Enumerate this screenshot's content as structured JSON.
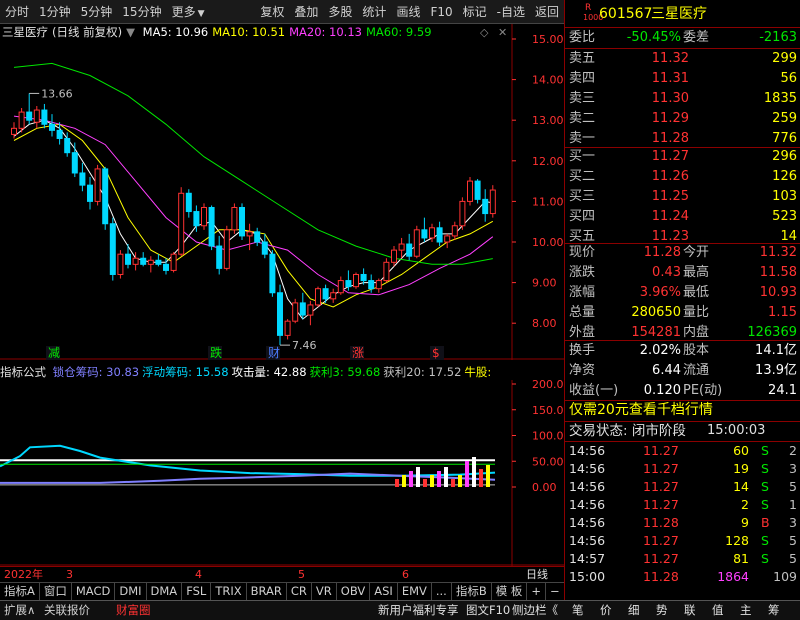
{
  "toolbar": {
    "left": [
      "分时",
      "1分钟",
      "5分钟",
      "15分钟",
      "更多"
    ],
    "right": [
      "复权",
      "叠加",
      "多股",
      "统计",
      "画线",
      "F10",
      "标记",
      "-自选",
      "返回"
    ]
  },
  "chart": {
    "stock_label": "三星医疗",
    "mode": "(日线 前复权)",
    "ma": [
      {
        "label": "MA5: 10.96",
        "color": "#ffffff"
      },
      {
        "label": "MA10: 10.51",
        "color": "#ffff00"
      },
      {
        "label": "MA20: 10.13",
        "color": "#ff40ff"
      },
      {
        "label": "MA60: 9.59",
        "color": "#00e600"
      }
    ],
    "high_label": "13.66",
    "low_label": "7.46",
    "events": [
      "减",
      "跌",
      "财",
      "涨",
      "$"
    ],
    "y_ticks": [
      "15.00",
      "14.00",
      "13.00",
      "12.00",
      "11.00",
      "10.00",
      "9.00",
      "8.00"
    ],
    "candles": [
      [
        12.65,
        12.95,
        12.55,
        12.8
      ],
      [
        12.8,
        13.3,
        12.7,
        13.2
      ],
      [
        13.2,
        13.66,
        12.9,
        13.0
      ],
      [
        12.95,
        13.35,
        12.8,
        13.25
      ],
      [
        13.25,
        13.4,
        12.8,
        12.9
      ],
      [
        12.9,
        13.15,
        12.6,
        12.75
      ],
      [
        12.75,
        12.95,
        12.4,
        12.55
      ],
      [
        12.55,
        12.7,
        12.1,
        12.2
      ],
      [
        12.2,
        12.45,
        11.6,
        11.7
      ],
      [
        11.7,
        11.95,
        11.25,
        11.4
      ],
      [
        11.4,
        11.6,
        10.8,
        11.0
      ],
      [
        11.0,
        11.9,
        10.9,
        11.8
      ],
      [
        11.8,
        11.85,
        10.3,
        10.45
      ],
      [
        10.45,
        10.6,
        9.05,
        9.2
      ],
      [
        9.2,
        9.8,
        9.1,
        9.7
      ],
      [
        9.7,
        9.95,
        9.35,
        9.45
      ],
      [
        9.45,
        9.75,
        9.3,
        9.6
      ],
      [
        9.6,
        9.75,
        9.4,
        9.45
      ],
      [
        9.45,
        9.65,
        9.25,
        9.55
      ],
      [
        9.55,
        9.7,
        9.4,
        9.45
      ],
      [
        9.45,
        9.6,
        9.2,
        9.3
      ],
      [
        9.3,
        9.75,
        9.25,
        9.7
      ],
      [
        9.7,
        11.35,
        9.65,
        11.2
      ],
      [
        11.2,
        11.3,
        10.6,
        10.75
      ],
      [
        10.75,
        10.9,
        10.25,
        10.4
      ],
      [
        10.4,
        10.95,
        10.3,
        10.85
      ],
      [
        10.85,
        10.9,
        9.8,
        9.9
      ],
      [
        9.9,
        10.15,
        9.2,
        9.35
      ],
      [
        9.35,
        10.4,
        9.3,
        10.3
      ],
      [
        10.3,
        10.95,
        10.2,
        10.85
      ],
      [
        10.85,
        10.95,
        10.05,
        10.15
      ],
      [
        10.15,
        10.45,
        9.8,
        10.25
      ],
      [
        10.25,
        10.35,
        9.9,
        10.0
      ],
      [
        10.0,
        10.2,
        9.6,
        9.7
      ],
      [
        9.7,
        9.8,
        8.65,
        8.75
      ],
      [
        8.75,
        8.95,
        7.46,
        7.7
      ],
      [
        7.7,
        8.1,
        7.6,
        8.05
      ],
      [
        8.05,
        8.6,
        8.0,
        8.5
      ],
      [
        8.5,
        8.75,
        8.1,
        8.2
      ],
      [
        8.2,
        8.55,
        7.95,
        8.45
      ],
      [
        8.45,
        8.9,
        8.4,
        8.85
      ],
      [
        8.85,
        8.95,
        8.5,
        8.6
      ],
      [
        8.6,
        8.85,
        8.5,
        8.75
      ],
      [
        8.75,
        9.15,
        8.7,
        9.05
      ],
      [
        9.05,
        9.3,
        8.8,
        8.9
      ],
      [
        8.9,
        9.25,
        8.85,
        9.2
      ],
      [
        9.2,
        9.35,
        8.95,
        9.05
      ],
      [
        9.05,
        9.2,
        8.75,
        8.85
      ],
      [
        8.85,
        9.1,
        8.75,
        9.05
      ],
      [
        9.05,
        9.6,
        9.0,
        9.5
      ],
      [
        9.5,
        9.9,
        9.4,
        9.8
      ],
      [
        9.8,
        10.1,
        9.6,
        9.95
      ],
      [
        9.95,
        10.2,
        9.55,
        9.65
      ],
      [
        9.65,
        10.4,
        9.6,
        10.3
      ],
      [
        10.3,
        10.6,
        10.0,
        10.1
      ],
      [
        10.1,
        10.45,
        10.0,
        10.35
      ],
      [
        10.35,
        10.5,
        9.9,
        10.0
      ],
      [
        10.0,
        10.2,
        9.85,
        10.15
      ],
      [
        10.15,
        10.5,
        10.05,
        10.4
      ],
      [
        10.4,
        11.1,
        10.3,
        11.0
      ],
      [
        11.0,
        11.6,
        10.9,
        11.5
      ],
      [
        11.5,
        11.55,
        10.95,
        11.05
      ],
      [
        11.05,
        11.3,
        10.5,
        10.7
      ],
      [
        10.7,
        11.4,
        10.6,
        11.28
      ]
    ],
    "ma_lines": [
      {
        "color": "#ffffff",
        "points": [
          [
            0,
            12.6
          ],
          [
            2,
            12.9
          ],
          [
            4,
            13.0
          ],
          [
            6,
            12.8
          ],
          [
            8,
            12.3
          ],
          [
            10,
            11.7
          ],
          [
            12,
            11.1
          ],
          [
            14,
            10.2
          ],
          [
            16,
            9.6
          ],
          [
            18,
            9.5
          ],
          [
            20,
            9.5
          ],
          [
            22,
            9.9
          ],
          [
            24,
            10.4
          ],
          [
            26,
            10.5
          ],
          [
            28,
            10.0
          ],
          [
            30,
            10.3
          ],
          [
            32,
            10.2
          ],
          [
            34,
            9.7
          ],
          [
            36,
            8.6
          ],
          [
            38,
            8.1
          ],
          [
            40,
            8.4
          ],
          [
            42,
            8.7
          ],
          [
            44,
            8.9
          ],
          [
            46,
            9.0
          ],
          [
            48,
            9.0
          ],
          [
            50,
            9.4
          ],
          [
            52,
            9.8
          ],
          [
            54,
            10.0
          ],
          [
            56,
            10.2
          ],
          [
            58,
            10.2
          ],
          [
            60,
            10.6
          ],
          [
            62,
            11.0
          ],
          [
            63,
            10.96
          ]
        ]
      },
      {
        "color": "#ffff00",
        "points": [
          [
            0,
            12.5
          ],
          [
            3,
            12.8
          ],
          [
            6,
            12.9
          ],
          [
            9,
            12.5
          ],
          [
            12,
            11.8
          ],
          [
            15,
            10.6
          ],
          [
            18,
            9.8
          ],
          [
            21,
            9.5
          ],
          [
            24,
            9.9
          ],
          [
            27,
            10.3
          ],
          [
            30,
            10.3
          ],
          [
            33,
            10.2
          ],
          [
            36,
            9.3
          ],
          [
            39,
            8.6
          ],
          [
            42,
            8.4
          ],
          [
            45,
            8.7
          ],
          [
            48,
            8.9
          ],
          [
            51,
            9.2
          ],
          [
            54,
            9.6
          ],
          [
            57,
            10.0
          ],
          [
            60,
            10.2
          ],
          [
            63,
            10.51
          ]
        ]
      },
      {
        "color": "#ff40ff",
        "points": [
          [
            0,
            13.1
          ],
          [
            4,
            13.0
          ],
          [
            8,
            12.8
          ],
          [
            12,
            12.4
          ],
          [
            16,
            11.5
          ],
          [
            20,
            10.6
          ],
          [
            24,
            10.0
          ],
          [
            28,
            9.8
          ],
          [
            32,
            10.0
          ],
          [
            36,
            9.8
          ],
          [
            40,
            9.2
          ],
          [
            44,
            8.75
          ],
          [
            48,
            8.7
          ],
          [
            52,
            8.95
          ],
          [
            56,
            9.35
          ],
          [
            60,
            9.7
          ],
          [
            63,
            10.13
          ]
        ]
      },
      {
        "color": "#00e600",
        "points": [
          [
            0,
            14.3
          ],
          [
            5,
            14.4
          ],
          [
            10,
            14.1
          ],
          [
            15,
            13.6
          ],
          [
            20,
            12.9
          ],
          [
            25,
            12.1
          ],
          [
            30,
            11.5
          ],
          [
            35,
            10.9
          ],
          [
            40,
            10.3
          ],
          [
            45,
            9.9
          ],
          [
            50,
            9.6
          ],
          [
            55,
            9.45
          ],
          [
            59,
            9.45
          ],
          [
            63,
            9.59
          ]
        ]
      }
    ]
  },
  "indicator": {
    "name": "指标公式",
    "items": [
      {
        "label": "锁仓筹码: 30.83",
        "color": "#8080ff"
      },
      {
        "label": "浮动筹码: 15.58",
        "color": "#00d8ff"
      },
      {
        "label": "攻击量: 42.88",
        "color": "#ffffff"
      },
      {
        "label": "获利3: 59.68",
        "color": "#00e600"
      },
      {
        "label": "获利20: 17.52",
        "color": "#c0c0c0"
      },
      {
        "label": "牛股:",
        "color": "#ffff00"
      }
    ],
    "y_ticks": [
      "200.0",
      "150.0",
      "100.0",
      "50.00",
      "0.00"
    ]
  },
  "xaxis": {
    "labels": [
      "2022年",
      "3",
      "4",
      "5",
      "6"
    ],
    "right": "日线"
  },
  "tabs": [
    "指标A",
    "窗口",
    "MACD",
    "DMI",
    "DMA",
    "FSL",
    "TRIX",
    "BRAR",
    "CR",
    "VR",
    "OBV",
    "ASI",
    "EMV",
    "...",
    "指标B",
    "模 板",
    "+",
    "−"
  ],
  "bottom": {
    "left": [
      "扩展∧",
      "关联报价",
      "财富圈"
    ],
    "mid": [
      "新用户福利专享",
      "图文F10",
      "侧边栏《"
    ],
    "right": [
      "笔",
      "价",
      "细",
      "势",
      "联",
      "值",
      "主",
      "筹"
    ]
  },
  "quote": {
    "code": "601567",
    "name": "三星医疗",
    "r_badge": "R",
    "l2_badge": "1000",
    "wei_bi_label": "委比",
    "wei_bi": "-50.45%",
    "wei_cha_label": "委差",
    "wei_cha": "-2163",
    "asks": [
      {
        "label": "卖五",
        "price": "11.32",
        "vol": "299"
      },
      {
        "label": "卖四",
        "price": "11.31",
        "vol": "56"
      },
      {
        "label": "卖三",
        "price": "11.30",
        "vol": "1835"
      },
      {
        "label": "卖二",
        "price": "11.29",
        "vol": "259"
      },
      {
        "label": "卖一",
        "price": "11.28",
        "vol": "776"
      }
    ],
    "bids": [
      {
        "label": "买一",
        "price": "11.27",
        "vol": "296"
      },
      {
        "label": "买二",
        "price": "11.26",
        "vol": "126"
      },
      {
        "label": "买三",
        "price": "11.25",
        "vol": "103"
      },
      {
        "label": "买四",
        "price": "11.24",
        "vol": "523"
      },
      {
        "label": "买五",
        "price": "11.23",
        "vol": "14"
      }
    ],
    "stats": [
      {
        "l1": "现价",
        "v1": "11.28",
        "c1": "red",
        "l2": "今开",
        "v2": "11.32",
        "c2": "red"
      },
      {
        "l1": "涨跌",
        "v1": "0.43",
        "c1": "red",
        "l2": "最高",
        "v2": "11.58",
        "c2": "red"
      },
      {
        "l1": "涨幅",
        "v1": "3.96%",
        "c1": "red",
        "l2": "最低",
        "v2": "10.93",
        "c2": "red"
      },
      {
        "l1": "总量",
        "v1": "280650",
        "c1": "yellow",
        "l2": "量比",
        "v2": "1.15",
        "c2": "red"
      },
      {
        "l1": "外盘",
        "v1": "154281",
        "c1": "red",
        "l2": "内盘",
        "v2": "126369",
        "c2": "green"
      }
    ],
    "stats2": [
      {
        "l1": "换手",
        "v1": "2.02%",
        "l2": "股本",
        "v2": "14.1亿"
      },
      {
        "l1": "净资",
        "v1": "6.44",
        "l2": "流通",
        "v2": "13.9亿"
      },
      {
        "l1": "收益(一)",
        "v1": "0.120",
        "l2": "PE(动)",
        "v2": "24.1"
      }
    ],
    "promo": "仅需20元查看千档行情",
    "status_label": "交易状态: 闭市阶段",
    "status_time": "15:00:03",
    "ticks": [
      {
        "time": "14:56",
        "price": "11.27",
        "vol": "60",
        "vc": "yellow",
        "bs": "S",
        "bc": "green",
        "n": "2"
      },
      {
        "time": "14:56",
        "price": "11.27",
        "vol": "19",
        "vc": "yellow",
        "bs": "S",
        "bc": "green",
        "n": "3"
      },
      {
        "time": "14:56",
        "price": "11.27",
        "vol": "14",
        "vc": "yellow",
        "bs": "S",
        "bc": "green",
        "n": "5"
      },
      {
        "time": "14:56",
        "price": "11.27",
        "vol": "2",
        "vc": "yellow",
        "bs": "S",
        "bc": "green",
        "n": "1"
      },
      {
        "time": "14:56",
        "price": "11.28",
        "vol": "9",
        "vc": "yellow",
        "bs": "B",
        "bc": "red",
        "n": "3"
      },
      {
        "time": "14:56",
        "price": "11.27",
        "vol": "128",
        "vc": "yellow",
        "bs": "S",
        "bc": "green",
        "n": "5"
      },
      {
        "time": "14:57",
        "price": "11.27",
        "vol": "81",
        "vc": "yellow",
        "bs": "S",
        "bc": "green",
        "n": "5"
      },
      {
        "time": "15:00",
        "price": "11.28",
        "vol": "1864",
        "vc": "mag",
        "bs": "",
        "bc": "gray",
        "n": "109"
      }
    ]
  }
}
